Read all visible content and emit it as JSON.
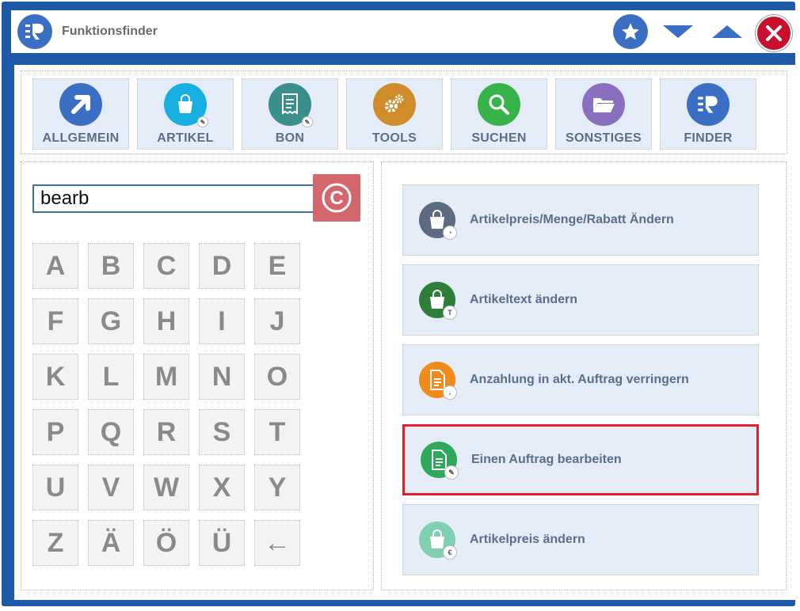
{
  "window": {
    "title": "Funktionsfinder"
  },
  "colors": {
    "frame": "#1f5aa8",
    "tab_bg": "#e3ecf7",
    "highlight": "#e0202a",
    "clear_button": "#d4666e"
  },
  "tabs": [
    {
      "label": "ALLGEMEIN",
      "icon": "arrow-up-right-icon",
      "color": "#3b6fc4"
    },
    {
      "label": "ARTIKEL",
      "icon": "shopping-bag-icon",
      "color": "#19aee0"
    },
    {
      "label": "BON",
      "icon": "receipt-icon",
      "color": "#3a8f8a"
    },
    {
      "label": "TOOLS",
      "icon": "gears-icon",
      "color": "#d08c2a"
    },
    {
      "label": "SUCHEN",
      "icon": "search-icon",
      "color": "#38b34a"
    },
    {
      "label": "SONSTIGES",
      "icon": "folder-icon",
      "color": "#8a6fbf"
    },
    {
      "label": "FINDER",
      "icon": "finder-logo-icon",
      "color": "#3b6fc4"
    }
  ],
  "search": {
    "value": "bearb",
    "clear_label": "C"
  },
  "keyboard": {
    "rows": [
      [
        "A",
        "B",
        "C",
        "D",
        "E"
      ],
      [
        "F",
        "G",
        "H",
        "I",
        "J"
      ],
      [
        "K",
        "L",
        "M",
        "N",
        "O"
      ],
      [
        "P",
        "Q",
        "R",
        "S",
        "T"
      ],
      [
        "U",
        "V",
        "W",
        "X",
        "Y"
      ],
      [
        "Z",
        "Ä",
        "Ö",
        "Ü",
        "←"
      ]
    ]
  },
  "results": [
    {
      "label": "Artikelpreis/Menge/Rabatt Ändern",
      "icon": "shopping-bag-icon",
      "color": "#5d6b80",
      "badge": "◔"
    },
    {
      "label": "Artikeltext ändern",
      "icon": "shopping-bag-icon",
      "color": "#2e7d3a",
      "badge": "T"
    },
    {
      "label": "Anzahlung in akt. Auftrag verringern",
      "icon": "document-icon",
      "color": "#f08a1c",
      "badge": "↓"
    },
    {
      "label": "Einen Auftrag bearbeiten",
      "icon": "document-icon",
      "color": "#2fa85c",
      "badge": "✎",
      "highlighted": true
    },
    {
      "label": "Artikelpreis ändern",
      "icon": "shopping-bag-icon",
      "color": "#7fcfb0",
      "badge": "€"
    }
  ]
}
